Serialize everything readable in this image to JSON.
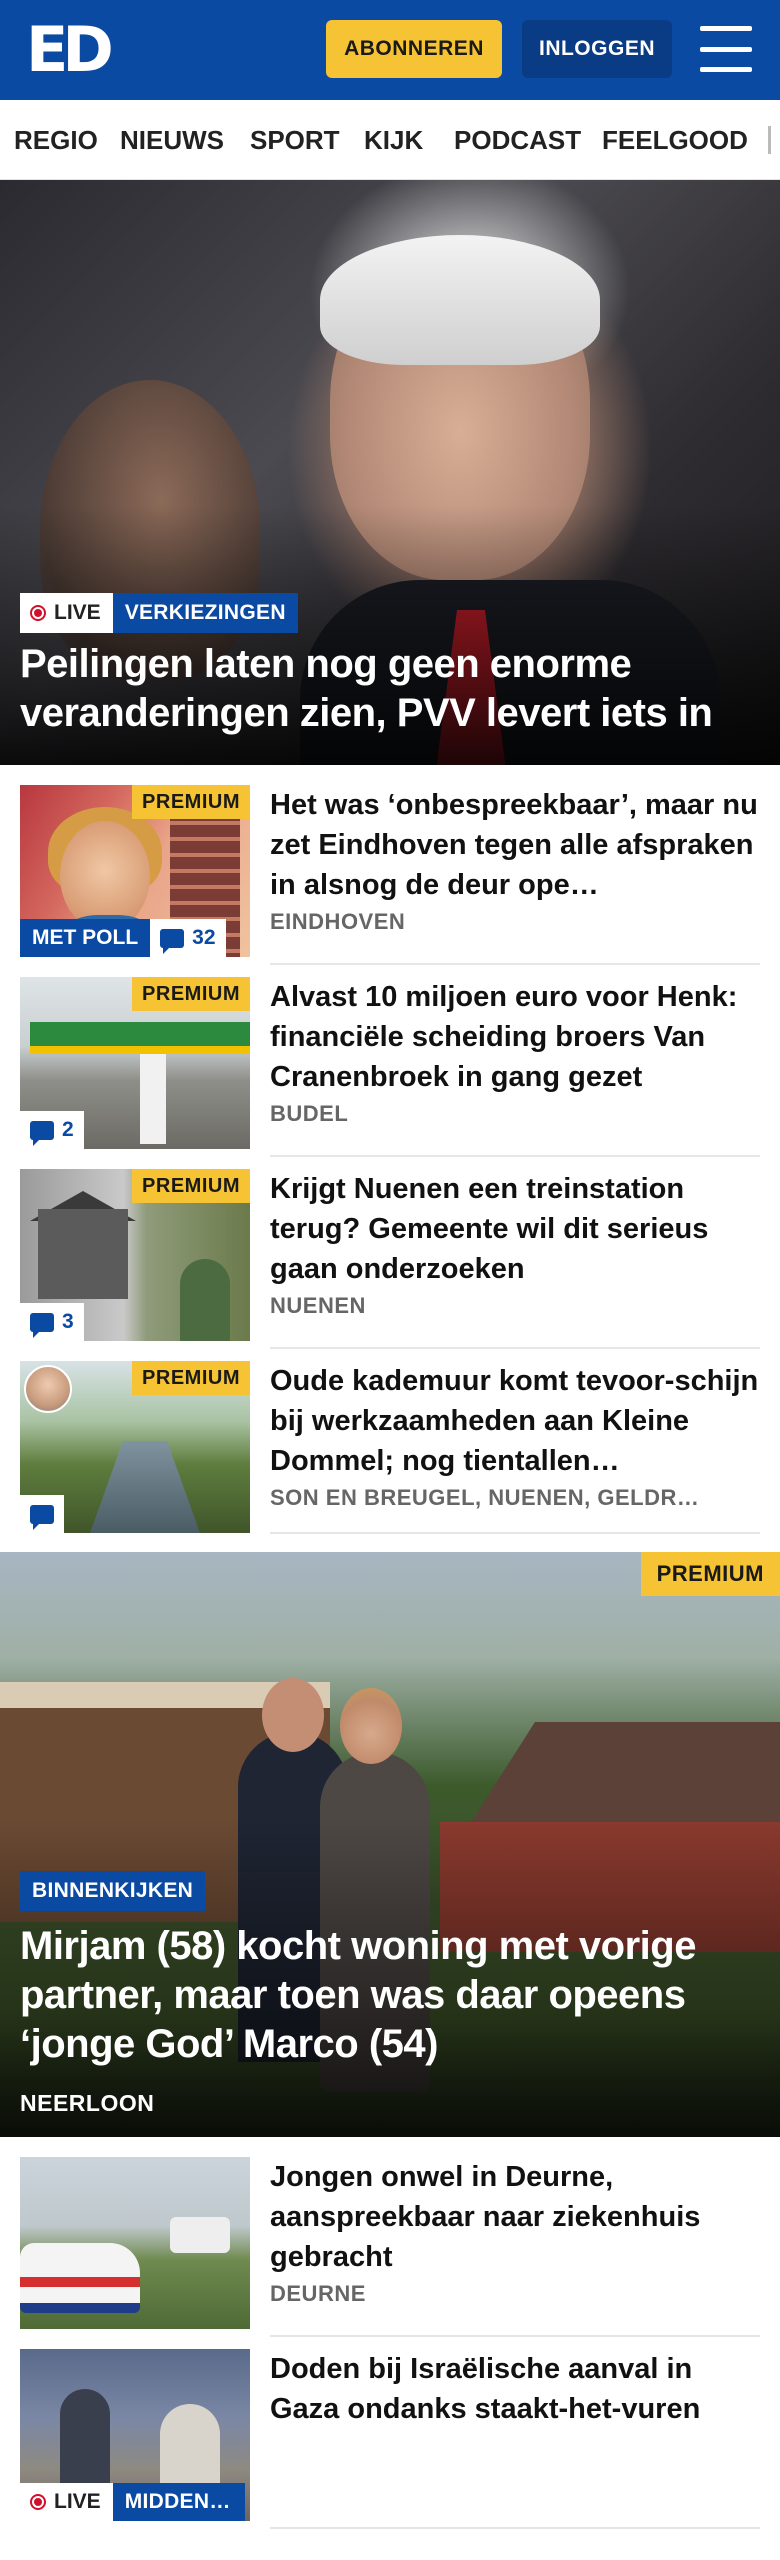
{
  "header": {
    "logo": "ED",
    "subscribe_label": "ABONNEREN",
    "login_label": "INLOGGEN"
  },
  "nav": {
    "items": [
      "REGIO",
      "NIEUWS",
      "SPORT",
      "KIJK",
      "PODCAST",
      "FEELGOOD"
    ]
  },
  "hero": {
    "live_label": "LIVE",
    "category": "VERKIEZINGEN",
    "title": "Peilingen laten nog geen enorme veranderingen zien, PVV levert iets in"
  },
  "articles": [
    {
      "title": "Het was ‘onbespreekbaar’, maar nu zet Eindhoven tegen alle afspraken in alsnog de deur ope…",
      "location": "EINDHOVEN",
      "premium": "PREMIUM",
      "poll": "MET POLL",
      "comments": "32"
    },
    {
      "title": "Alvast 10 miljoen euro voor Henk: financiële scheiding broers Van Cranenbroek in gang gezet",
      "location": "BUDEL",
      "premium": "PREMIUM",
      "comments": "2"
    },
    {
      "title": "Krijgt Nuenen een treinstation terug? Gemeente wil dit serieus gaan onderzoeken",
      "location": "NUENEN",
      "premium": "PREMIUM",
      "comments": "3"
    },
    {
      "title": "Oude kademuur komt tevoor-schijn bij werkzaamheden aan Kleine Dommel; nog tientallen…",
      "location": "SON EN BREUGEL, NUENEN, GELDR…",
      "premium": "PREMIUM",
      "comments": ""
    }
  ],
  "feature": {
    "premium": "PREMIUM",
    "category": "BINNENKIJKEN",
    "title": "Mirjam (58) kocht woning met vorige partner, maar toen was daar opeens ‘jonge God’ Marco (54)",
    "location": "NEERLOON"
  },
  "more_articles": [
    {
      "title": "Jongen onwel in Deurne, aanspreekbaar naar ziekenhuis gebracht",
      "location": "DEURNE"
    },
    {
      "title": "Doden bij Israëlische aanval in Gaza ondanks staakt-het-vuren",
      "live_label": "LIVE",
      "category": "MIDDEN-…"
    }
  ],
  "icons": [
    "hamburger-menu-icon",
    "comment-bubble-icon",
    "live-dot-icon"
  ],
  "colors": {
    "brand_blue": "#0b4aa2",
    "premium_yellow": "#f5c333",
    "live_red": "#d0112b"
  }
}
